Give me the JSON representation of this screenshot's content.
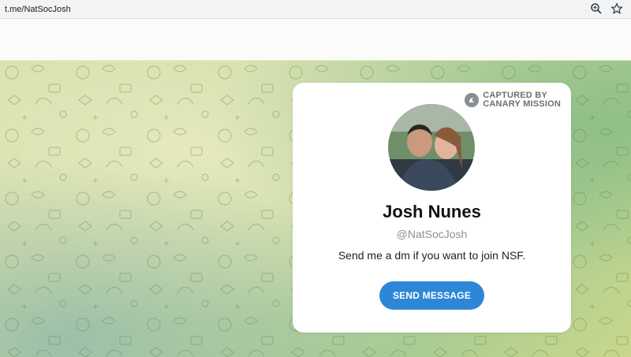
{
  "browser": {
    "url": "t.me/NatSocJosh",
    "icons": [
      "zoom-icon",
      "star-icon"
    ]
  },
  "watermark": {
    "line1": "CAPTURED BY",
    "line2": "CANARY MISSION"
  },
  "profile": {
    "name": "Josh Nunes",
    "username": "@NatSocJosh",
    "bio": "Send me a dm if you want to join NSF.",
    "send_button": "SEND MESSAGE"
  },
  "colors": {
    "button": "#2e87d6",
    "card": "#ffffff"
  }
}
